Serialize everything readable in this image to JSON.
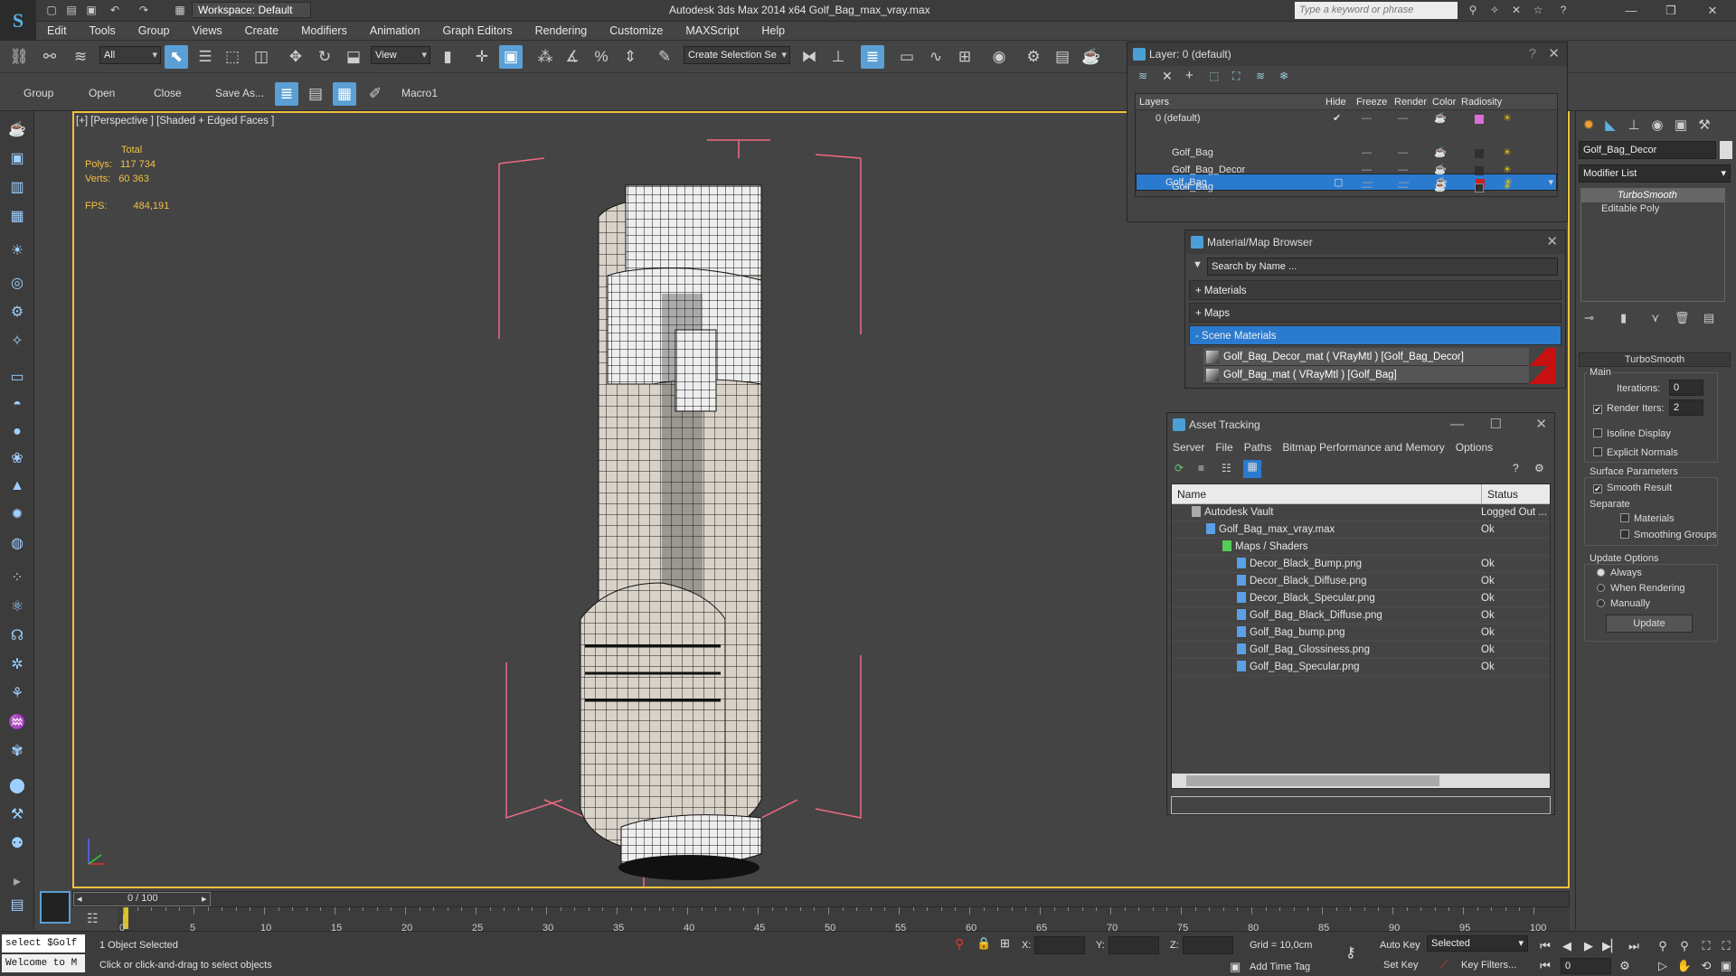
{
  "app": {
    "workspace": "Workspace: Default",
    "title": "Autodesk 3ds Max  2014 x64      Golf_Bag_max_vray.max",
    "search_placeholder": "Type a keyword or phrase"
  },
  "menu": [
    "Edit",
    "Tools",
    "Group",
    "Views",
    "Create",
    "Modifiers",
    "Animation",
    "Graph Editors",
    "Rendering",
    "Customize",
    "MAXScript",
    "Help"
  ],
  "toolbar": {
    "filter": "All",
    "coord": "View",
    "selection_set": "Create Selection Se"
  },
  "ribbon": [
    "Group",
    "Open",
    "Close",
    "Save As...",
    "Macro1"
  ],
  "viewport": {
    "label": "[+] [Perspective ] [Shaded + Edged Faces ]",
    "stats_total": "Total",
    "polys_label": "Polys:",
    "polys": "117 734",
    "verts_label": "Verts:",
    "verts": "60 363",
    "fps_label": "FPS:",
    "fps": "484,191"
  },
  "layers": {
    "title": "Layer: 0 (default)",
    "cols": [
      "Layers",
      "Hide",
      "Freeze",
      "Render",
      "Color",
      "Radiosity"
    ],
    "rows": [
      {
        "name": "0 (default)",
        "color": "#d870d8"
      },
      {
        "name": "Golf_Bag",
        "color": "#c82020"
      },
      {
        "name": "Golf_Bag",
        "color": "#303030"
      },
      {
        "name": "Golf_Bag_Decor",
        "color": "#303030"
      },
      {
        "name": "Golf_Bag",
        "color": "#303030"
      }
    ]
  },
  "material_browser": {
    "title": "Material/Map Browser",
    "search": "Search by Name ...",
    "groups": [
      "+ Materials",
      "+ Maps",
      "- Scene Materials"
    ],
    "materials": [
      "Golf_Bag_Decor_mat  ( VRayMtl ) [Golf_Bag_Decor]",
      "Golf_Bag_mat  ( VRayMtl ) [Golf_Bag]"
    ]
  },
  "asset_tracking": {
    "title": "Asset Tracking",
    "menu": [
      "Server",
      "File",
      "Paths",
      "Bitmap Performance and Memory",
      "Options"
    ],
    "col_name": "Name",
    "col_status": "Status",
    "rows": [
      {
        "name": "Autodesk Vault",
        "status": "Logged Out ...",
        "indent": 1
      },
      {
        "name": "Golf_Bag_max_vray.max",
        "status": "Ok",
        "indent": 2
      },
      {
        "name": "Maps / Shaders",
        "status": "",
        "indent": 3
      },
      {
        "name": "Decor_Black_Bump.png",
        "status": "Ok",
        "indent": 4
      },
      {
        "name": "Decor_Black_Diffuse.png",
        "status": "Ok",
        "indent": 4
      },
      {
        "name": "Decor_Black_Specular.png",
        "status": "Ok",
        "indent": 4
      },
      {
        "name": "Golf_Bag_Black_Diffuse.png",
        "status": "Ok",
        "indent": 4
      },
      {
        "name": "Golf_Bag_bump.png",
        "status": "Ok",
        "indent": 4
      },
      {
        "name": "Golf_Bag_Glossiness.png",
        "status": "Ok",
        "indent": 4
      },
      {
        "name": "Golf_Bag_Specular.png",
        "status": "Ok",
        "indent": 4
      }
    ]
  },
  "modify": {
    "object_name": "Golf_Bag_Decor",
    "modifier_list": "Modifier List",
    "stack": [
      "TurboSmooth",
      "Editable Poly"
    ],
    "rollout": "TurboSmooth",
    "main": "Main",
    "iterations_label": "Iterations:",
    "iterations": "0",
    "render_iters_label": "Render Iters:",
    "render_iters": "2",
    "isoline": "Isoline Display",
    "explicit": "Explicit Normals",
    "surface": "Surface Parameters",
    "smooth": "Smooth Result",
    "separate": "Separate",
    "materials": "Materials",
    "smoothing": "Smoothing Groups",
    "update_opts": "Update Options",
    "always": "Always",
    "when_rendering": "When Rendering",
    "manually": "Manually",
    "update": "Update"
  },
  "timeline": {
    "frame": "0 / 100",
    "ticks": [
      "0",
      "5",
      "10",
      "15",
      "20",
      "25",
      "30",
      "35",
      "40",
      "45",
      "50",
      "55",
      "60",
      "65",
      "70",
      "75",
      "80",
      "85",
      "90",
      "95",
      "100"
    ]
  },
  "status": {
    "script1": "select $Golf",
    "script2": "Welcome to M",
    "selected": "1 Object Selected",
    "prompt": "Click or click-and-drag to select objects",
    "x": "X:",
    "y": "Y:",
    "z": "Z:",
    "grid": "Grid = 10,0cm",
    "auto_key": "Auto Key",
    "set_key": "Set Key",
    "selected_dd": "Selected",
    "key_filters": "Key Filters...",
    "add_time_tag": "Add Time Tag",
    "frame_field": "0"
  }
}
